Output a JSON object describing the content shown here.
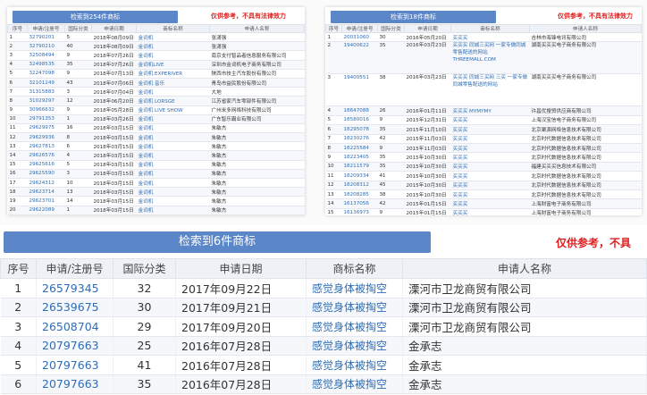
{
  "left_panel": {
    "title": "检索到254件商标",
    "note": "仅供参考，不具有法律效力",
    "headers": [
      "序号",
      "申请/注册号",
      "国际分类",
      "申请日期",
      "商标名称",
      "申请人名称"
    ],
    "rows": [
      [
        "1",
        "32790201",
        "5",
        "2018年08月09日",
        "金词机",
        "张潇强"
      ],
      [
        "2",
        "32790210",
        "40",
        "2018年08月09日",
        "金词机",
        "张潇强"
      ],
      [
        "3",
        "32508494",
        "9",
        "2018年07月26日",
        "金词机",
        "南京支付智品者信息服务有限公司"
      ],
      [
        "4",
        "32498535",
        "35",
        "2018年07月26日",
        "金词机LIVE",
        "深圳市金词机电子商务有限公司"
      ],
      [
        "5",
        "32247098",
        "9",
        "2018年07月13日",
        "金词机 EXPERIVER",
        "陕西市技主汽车股份有限公司"
      ],
      [
        "6",
        "32101249",
        "43",
        "2018年07月06日",
        "金词机 音乐",
        "青岛市益民股份有限公司"
      ],
      [
        "7",
        "31315883",
        "3",
        "2018年07月04日",
        "金词机",
        "大地"
      ],
      [
        "8",
        "31029297",
        "12",
        "2018年06月20日",
        "金词机 LORSGE",
        "江苏省家汽车零部件有限公司"
      ],
      [
        "9",
        "30966632",
        "9",
        "2018年05月28日",
        "金词机 LIVE SHOW",
        "广州米多网络科技有限公司"
      ],
      [
        "10",
        "29791353",
        "1",
        "2018年03月26日",
        "金词机",
        "广东智乐霸业有限公司"
      ],
      [
        "11",
        "29629975",
        "16",
        "2018年03月15日",
        "金词机",
        "朱敏杰"
      ],
      [
        "12",
        "29629936",
        "8",
        "2018年03月15日",
        "金词机",
        "朱敏杰"
      ],
      [
        "13",
        "29627813",
        "6",
        "2018年03月15日",
        "金词机",
        "朱敏杰"
      ],
      [
        "14",
        "29626576",
        "4",
        "2018年03月15日",
        "金词机",
        "朱敏杰"
      ],
      [
        "15",
        "29625616",
        "5",
        "2018年03月15日",
        "金词机",
        "朱敏杰"
      ],
      [
        "16",
        "29625590",
        "3",
        "2018年03月15日",
        "金词机",
        "朱敏杰"
      ],
      [
        "17",
        "29624312",
        "10",
        "2018年03月15日",
        "金词机",
        "朱敏杰"
      ],
      [
        "18",
        "29623714",
        "13",
        "2018年03月15日",
        "金词机",
        "朱敏杰"
      ],
      [
        "19",
        "29623701",
        "14",
        "2018年03月15日",
        "金词机",
        "朱敏杰"
      ],
      [
        "20",
        "29622089",
        "1",
        "2018年03月15日",
        "金词机",
        "朱敏杰"
      ],
      [
        "21",
        "29621285",
        "2",
        "2018年03月15日",
        "金词机",
        "朱敏杰"
      ],
      [
        "22",
        "29620961",
        "7",
        "2018年03月15日",
        "金词机",
        "朱敏杰"
      ]
    ]
  },
  "right_panel": {
    "title": "检索到18件商标",
    "note": "仅供参考，不具有法律效力",
    "headers": [
      "序号",
      "申请/注册号",
      "国际分类",
      "申请日期",
      "商标名称",
      "申请人名称"
    ],
    "rows": [
      [
        "1",
        "20031060",
        "30",
        "2016年05月20日",
        "买买买",
        "吉林市海锋电讯有限公司"
      ],
      [
        "2",
        "19400622",
        "35",
        "2016年03月23日",
        "买买买 同城三买网 一家专做同城零售配送的网站 THREEMALL.COM",
        "湖南买买买电子商务有限公司"
      ],
      [
        "3",
        "19400551",
        "38",
        "2016年03月23日",
        "买买买 同城三买网 三买 一家专做同城零售配送的网站",
        "湖南买买买电子商务有限公司"
      ],
      [
        "4",
        "18647088",
        "26",
        "2016年01月11日",
        "买买买 MYMYMY",
        "许昌优搜贸供应商有限公司"
      ],
      [
        "5",
        "18580016",
        "9",
        "2015年12月31日",
        "买买买",
        "上海汉宝信电子商务有限公司"
      ],
      [
        "6",
        "18295078",
        "35",
        "2015年11月10日",
        "买买买",
        "北京聚源网络信息技术有限公司"
      ],
      [
        "7",
        "18230276",
        "42",
        "2015年11月03日",
        "买买买",
        "北京时代数据信息技术有限公司"
      ],
      [
        "8",
        "18225584",
        "9",
        "2015年11月03日",
        "买买买",
        "北京时代数据信息技术有限公司"
      ],
      [
        "9",
        "18223405",
        "35",
        "2015年10月30日",
        "买买买",
        "北京时代数据信息技术有限公司"
      ],
      [
        "10",
        "18211579",
        "35",
        "2015年10月30日",
        "买买买",
        "福建买买买信息技术有限公司"
      ],
      [
        "11",
        "18209334",
        "41",
        "2015年10月30日",
        "买买买",
        "北京时代数据信息技术有限公司"
      ],
      [
        "12",
        "18208312",
        "45",
        "2015年10月30日",
        "买买买",
        "北京时代数据信息技术有限公司"
      ],
      [
        "13",
        "18208285",
        "38",
        "2015年10月30日",
        "买买买",
        "北京时代数据信息技术有限公司"
      ],
      [
        "14",
        "16137056",
        "42",
        "2015年01月15日",
        "买买买",
        "上海财富电子商务有限公司"
      ],
      [
        "15",
        "16136973",
        "9",
        "2015年01月15日",
        "买买买",
        "上海财富电子商务有限公司"
      ],
      [
        "16",
        "16136967",
        "35",
        "2015年01月15日",
        "买买买",
        "上海财富电子商务有限公司"
      ],
      [
        "17",
        "16019267",
        "42",
        "2014年12月30日",
        "买买买",
        "厦门市以智能技术有限公司"
      ],
      [
        "18",
        "10706397",
        "35",
        "2012年03月30日",
        "买买买",
        "广州买买买电子商务有限公司"
      ]
    ]
  },
  "bottom_panel": {
    "title": "检索到6件商标",
    "note": "仅供参考，不具",
    "headers": [
      "序号",
      "申请/注册号",
      "国际分类",
      "申请日期",
      "商标名称",
      "申请人名称"
    ],
    "rows": [
      [
        "1",
        "26579345",
        "32",
        "2017年09月22日",
        "感觉身体被掏空",
        "溧河市卫龙商贸有限公司"
      ],
      [
        "2",
        "26539675",
        "30",
        "2017年09月21日",
        "感觉身体被掏空",
        "溧河市卫龙商贸有限公司"
      ],
      [
        "3",
        "26508704",
        "29",
        "2017年09月20日",
        "感觉身体被掏空",
        "溧河市卫龙商贸有限公司"
      ],
      [
        "4",
        "20797663",
        "25",
        "2016年07月28日",
        "感觉身体被掏空",
        "金承志"
      ],
      [
        "5",
        "20797663",
        "41",
        "2016年07月28日",
        "感觉身体被掏空",
        "金承志"
      ],
      [
        "6",
        "20797663",
        "35",
        "2016年07月28日",
        "感觉身体被掏空",
        "金承志"
      ]
    ]
  },
  "colors": {
    "accent": "#5b86c8",
    "link": "#2f6db5",
    "warning": "#e02020"
  }
}
